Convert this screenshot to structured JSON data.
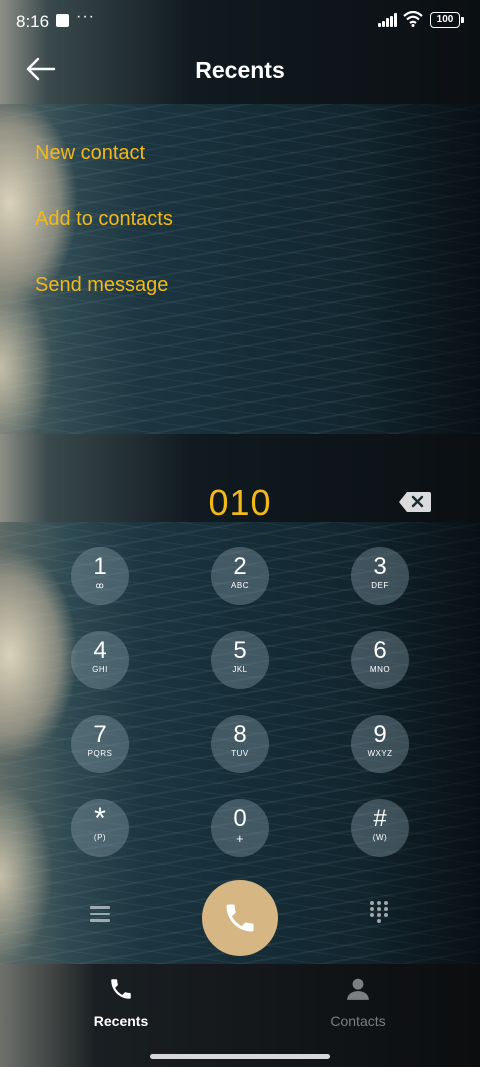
{
  "status_bar": {
    "time": "8:16",
    "overflow": "···",
    "battery": "100"
  },
  "header": {
    "title": "Recents"
  },
  "menu": {
    "items": [
      "New contact",
      "Add to contacts",
      "Send message"
    ]
  },
  "dialer": {
    "number": "010",
    "keys": [
      {
        "digit": "1",
        "sub": "ꝏ"
      },
      {
        "digit": "2",
        "sub": "ABC"
      },
      {
        "digit": "3",
        "sub": "DEF"
      },
      {
        "digit": "4",
        "sub": "GHI"
      },
      {
        "digit": "5",
        "sub": "JKL"
      },
      {
        "digit": "6",
        "sub": "MNO"
      },
      {
        "digit": "7",
        "sub": "PQRS"
      },
      {
        "digit": "8",
        "sub": "TUV"
      },
      {
        "digit": "9",
        "sub": "WXYZ"
      },
      {
        "digit": "*",
        "sub": "(P)"
      },
      {
        "digit": "0",
        "sub": "+"
      },
      {
        "digit": "#",
        "sub": "(W)"
      }
    ]
  },
  "nav": {
    "tabs": [
      {
        "label": "Recents",
        "icon": "phone-icon"
      },
      {
        "label": "Contacts",
        "icon": "person-icon"
      }
    ]
  },
  "colors": {
    "accent": "#f2b91b",
    "call_button": "#d6b683"
  }
}
